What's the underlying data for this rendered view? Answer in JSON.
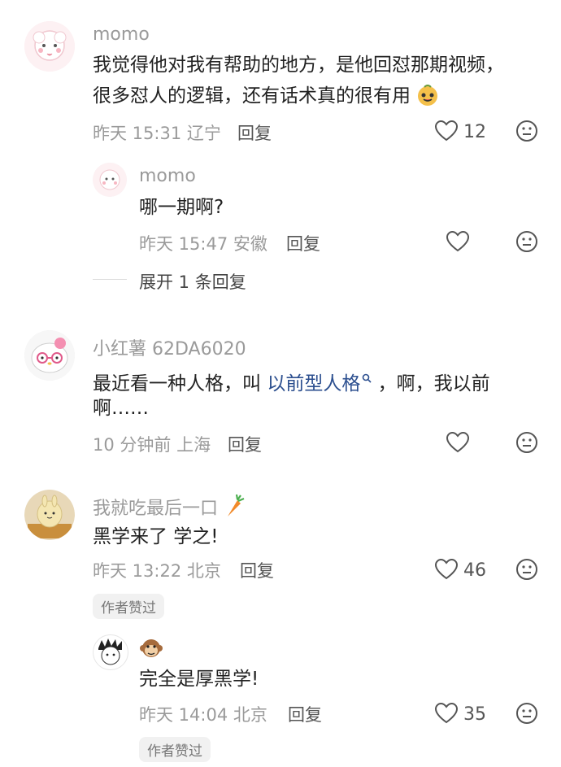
{
  "comments": [
    {
      "author": "momo",
      "text_line1": "我觉得他对我有帮助的地方，是他回怼那期视频，",
      "text_line2": "很多怼人的逻辑，还有话术真的很有用",
      "emoji": "happy-fruit-emoji",
      "time": "昨天 15:31",
      "location": "辽宁",
      "reply_label": "回复",
      "likes": "12",
      "reply": {
        "author": "momo",
        "text": "哪一期啊?",
        "time": "昨天 15:47",
        "location": "安徽",
        "reply_label": "回复"
      },
      "expand_label": "展开 1 条回复"
    },
    {
      "author": "小红薯 62DA6020",
      "text_prefix": "最近看一种人格，叫",
      "link_text": "以前型人格",
      "text_suffix": "，啊，我以前",
      "text_line2": "啊……",
      "time": "10 分钟前",
      "location": "上海",
      "reply_label": "回复"
    },
    {
      "author": "我就吃最后一口",
      "author_emoji": "carrot-emoji",
      "text": "黑学来了 学之!",
      "time": "昨天 13:22",
      "location": "北京",
      "reply_label": "回复",
      "likes": "46",
      "badge": "作者赞过",
      "reply": {
        "author_emoji": "monkey-emoji",
        "text": "完全是厚黑学!",
        "time": "昨天 14:04",
        "location": "北京",
        "reply_label": "回复",
        "likes": "35",
        "badge": "作者赞过"
      }
    }
  ],
  "icons": {
    "like": "heart-outline-icon",
    "dislike": "meh-face-icon"
  },
  "colors": {
    "link": "#2c4f8f",
    "secondary_text": "#9a9a9a"
  }
}
